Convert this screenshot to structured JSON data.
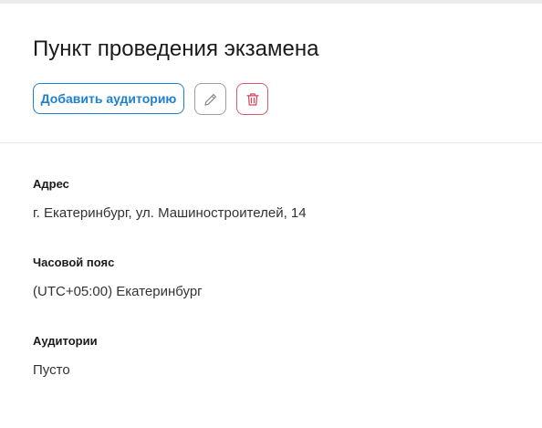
{
  "header": {
    "title": "Пункт проведения экзамена",
    "add_room_label": "Добавить аудиторию",
    "edit_icon": "pencil-icon",
    "delete_icon": "trash-icon"
  },
  "details": {
    "address": {
      "label": "Адрес",
      "value": "г. Екатеринбург, ул. Машиностроителей, 14"
    },
    "timezone": {
      "label": "Часовой пояс",
      "value": "(UTC+05:00) Екатеринбург"
    },
    "rooms": {
      "label": "Аудитории",
      "value": "Пусто"
    }
  },
  "colors": {
    "accent": "#1f7fd1",
    "danger": "#d65a6e",
    "neutral_border": "#9e9e9e"
  }
}
